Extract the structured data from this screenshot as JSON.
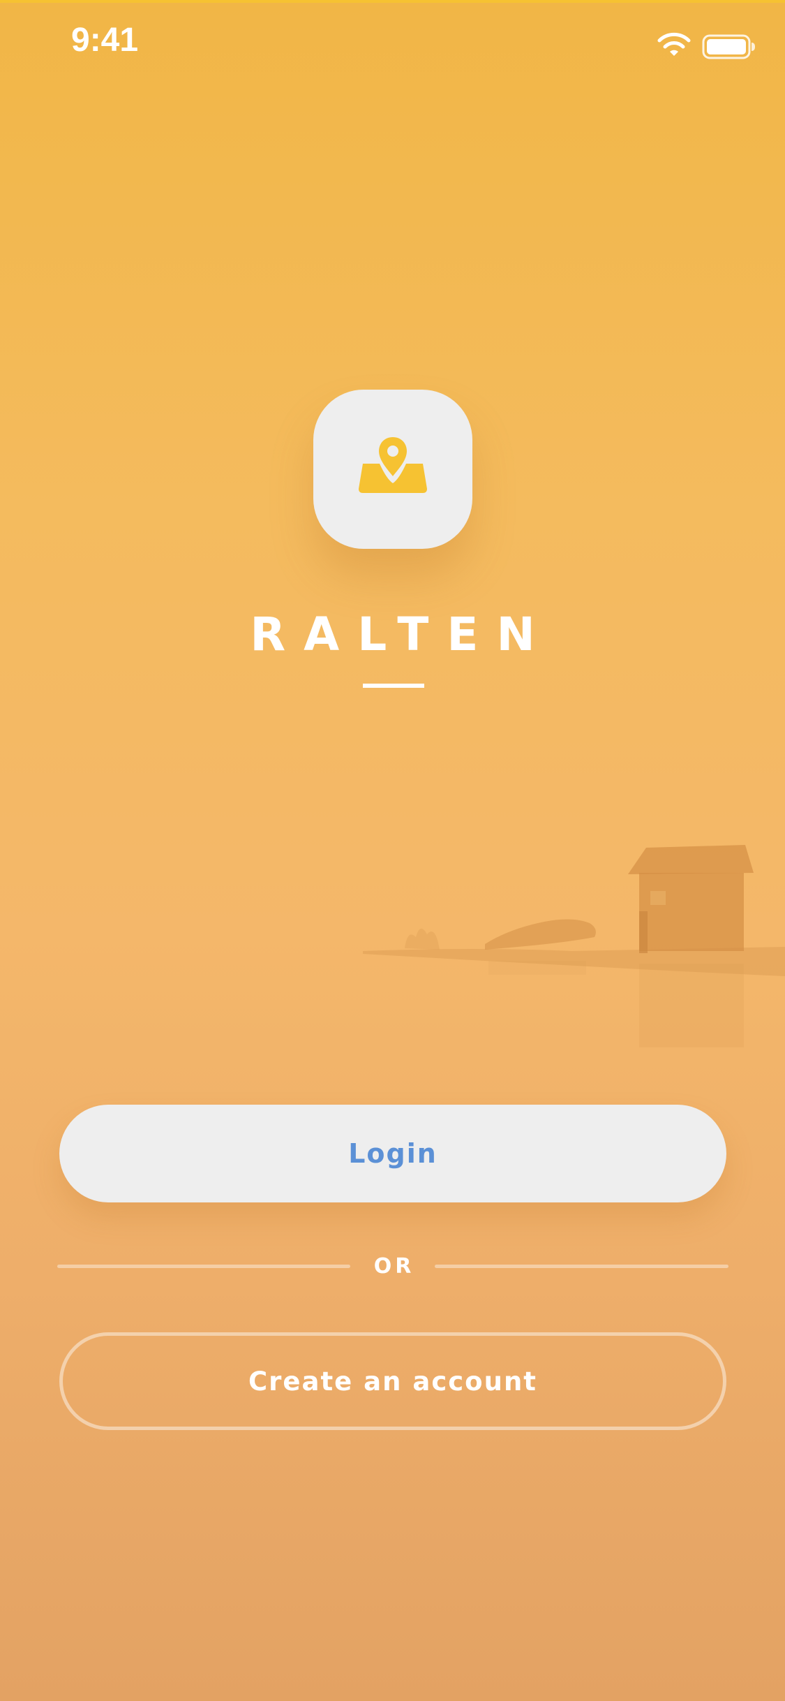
{
  "status_bar": {
    "time": "9:41",
    "wifi_icon": "wifi-icon",
    "battery_icon": "battery-icon"
  },
  "brand": {
    "name": "RALTEN",
    "icon": "map-pin-icon",
    "accent_color": "#f6c232"
  },
  "actions": {
    "login_label": "Login",
    "separator_label": "OR",
    "create_account_label": "Create an account"
  },
  "colors": {
    "background_top": "#f1b646",
    "background_bottom": "#e3a263",
    "login_text": "#5b90d6",
    "button_fill": "#eeeeee"
  }
}
